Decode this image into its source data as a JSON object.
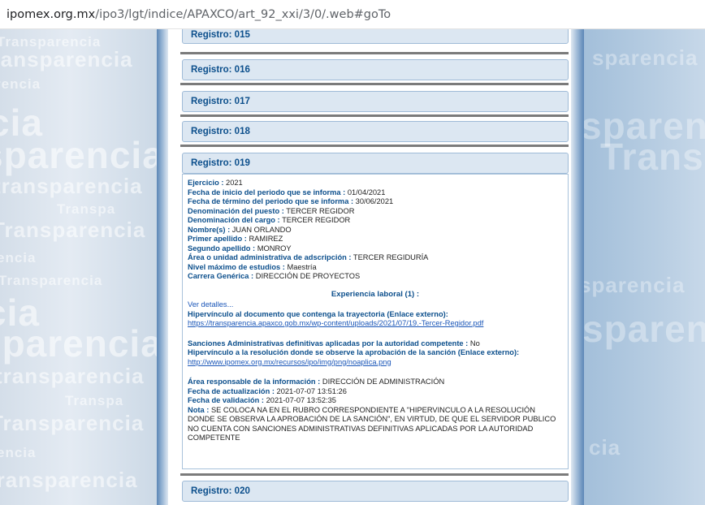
{
  "browser": {
    "url_domain": "ipomex.org.mx",
    "url_path": "/ipo3/lgt/indice/APAXCO/art_92_xxi/3/0/.web#goTo"
  },
  "background_watermark": {
    "words": [
      "Transparencia",
      "transparencia",
      "sparencia",
      "Transpa",
      "Tra",
      "rencia",
      "cia",
      "encia",
      "Trans"
    ]
  },
  "registros": {
    "r015": "Registro: 015",
    "r016": "Registro: 016",
    "r017": "Registro: 017",
    "r018": "Registro: 018",
    "r019": "Registro: 019",
    "r020": "Registro: 020"
  },
  "detail": {
    "ejercicio": {
      "label": "Ejercicio :",
      "value": "2021"
    },
    "fecha_inicio": {
      "label": "Fecha de inicio del periodo que se informa :",
      "value": "01/04/2021"
    },
    "fecha_termino": {
      "label": "Fecha de término del periodo que se informa :",
      "value": "30/06/2021"
    },
    "denominacion_puesto": {
      "label": "Denominación del puesto :",
      "value": "TERCER REGIDOR"
    },
    "denominacion_cargo": {
      "label": "Denominación del cargo :",
      "value": "TERCER REGIDOR"
    },
    "nombres": {
      "label": "Nombre(s) :",
      "value": "JUAN ORLANDO"
    },
    "primer_apellido": {
      "label": "Primer apellido :",
      "value": "RAMIREZ"
    },
    "segundo_apellido": {
      "label": "Segundo apellido :",
      "value": "MONROY"
    },
    "area_adscripcion": {
      "label": "Área o unidad administrativa de adscripción :",
      "value": "TERCER REGIDURÍA"
    },
    "nivel_estudios": {
      "label": "Nivel máximo de estudios :",
      "value": "Maestría"
    },
    "carrera": {
      "label": "Carrera Genérica :",
      "value": "DIRECCIÓN DE PROYECTOS"
    },
    "experiencia_title": "Experiencia laboral (1) :",
    "ver_detalles": "Ver detalles...",
    "hipervinculo_trayectoria": {
      "label": "Hipervínculo al documento que contenga la trayectoria (Enlace externo):",
      "url": "https://transparencia.apaxco.gob.mx/wp-content/uploads/2021/07/19.-Tercer-Regidor.pdf"
    },
    "sanciones": {
      "label": "Sanciones Administrativas definitivas aplicadas por la autoridad competente :",
      "value": "No"
    },
    "hipervinculo_sancion": {
      "label": "Hipervínculo a la resolución donde se observe la aprobación de la sanción (Enlace externo):",
      "url": "http://www.ipomex.org.mx/recursos/ipo/img/png/noaplica.png"
    },
    "area_responsable": {
      "label": "Área responsable de la información :",
      "value": "DIRECCIÓN DE ADMINISTRACIÓN"
    },
    "fecha_actualizacion": {
      "label": "Fecha de actualización :",
      "value": "2021-07-07 13:51:26"
    },
    "fecha_validacion": {
      "label": "Fecha de validación :",
      "value": "2021-07-07 13:52:35"
    },
    "nota": {
      "label": "Nota :",
      "value": "SE COLOCA NA EN EL RUBRO CORRESPONDIENTE A \"HIPERVINCULO A LA RESOLUCIÓN DONDE SE OBSERVA LA APROBACIÓN DE LA SANCIÓN\", EN VIRTUD, DE QUE EL SERVIDOR PUBLICO NO CUENTA CON SANCIONES ADMINISTRATIVAS DEFINITIVAS APLICADAS POR LA AUTORIDAD COMPETENTE"
    }
  }
}
